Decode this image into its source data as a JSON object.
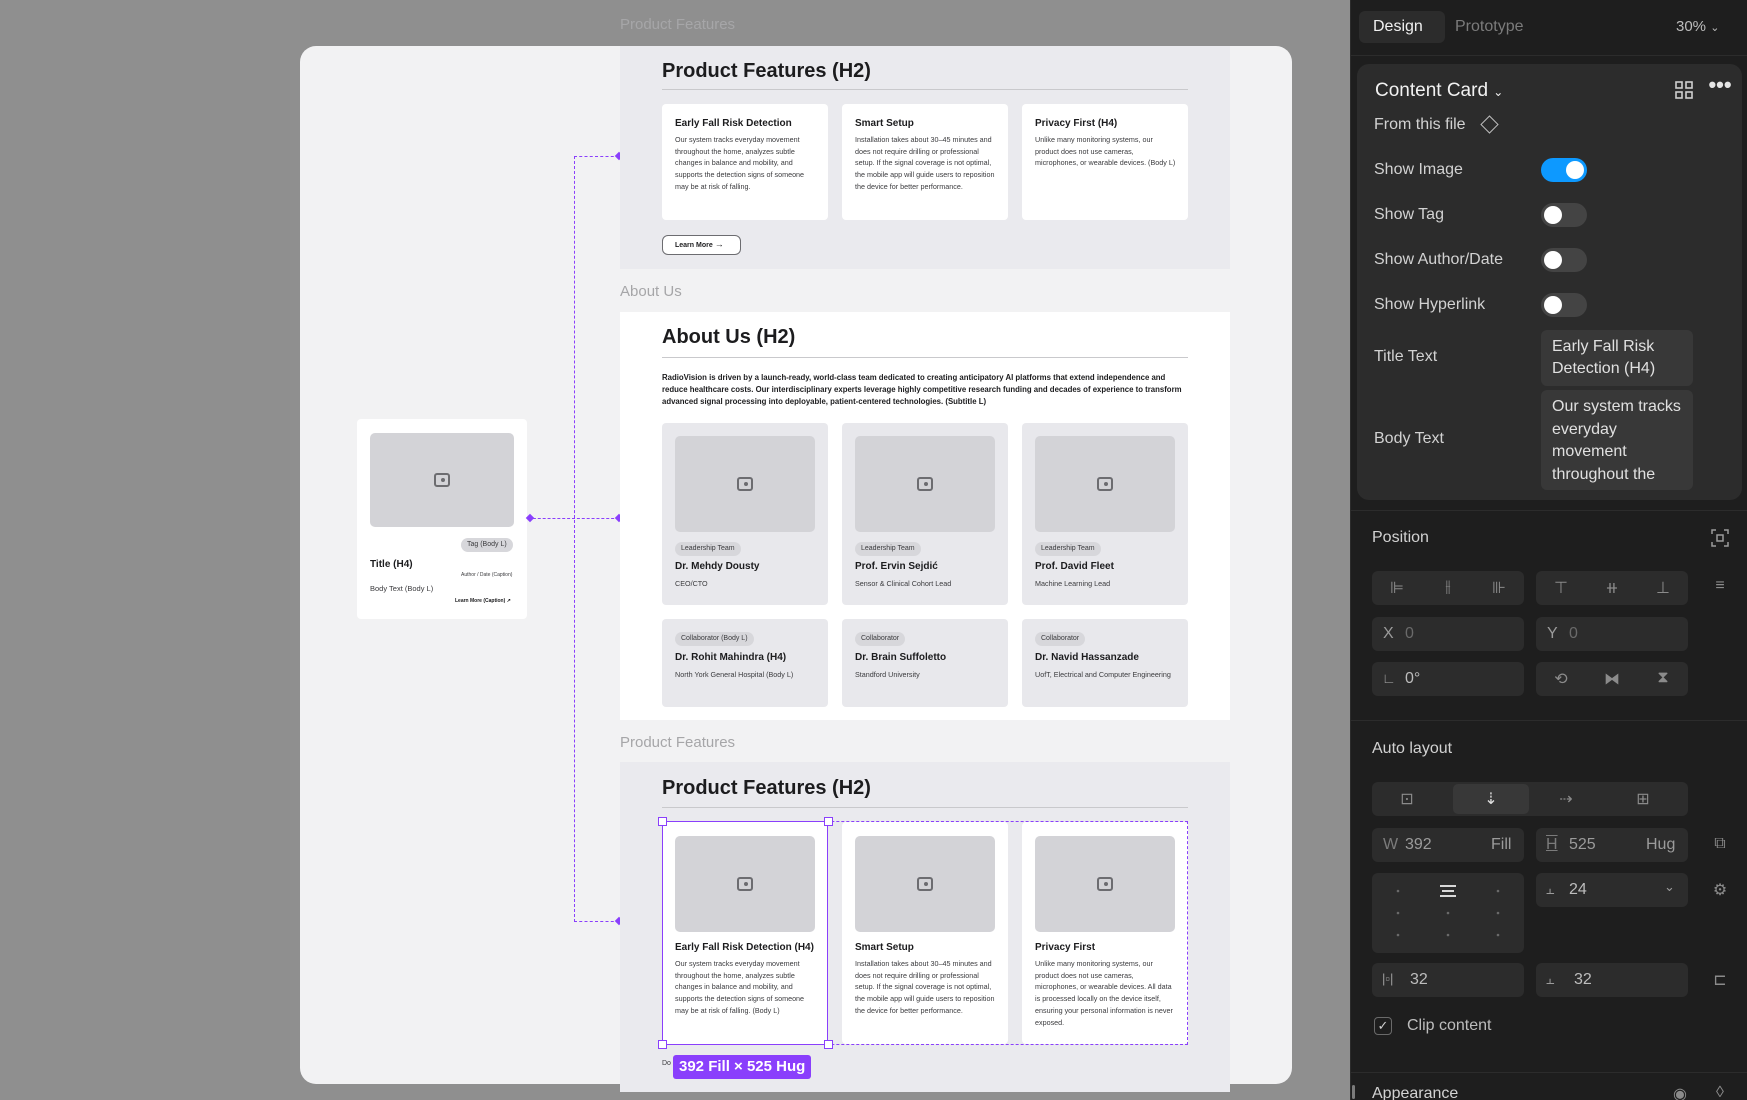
{
  "canvas": {
    "top_label": "Product Features",
    "about_label": "About Us",
    "bottom_label": "Product Features",
    "component_card": {
      "tag": "Tag (Body L)",
      "title": "Title (H4)",
      "author": "Author / Date (Caption)",
      "body": "Body Text (Body L)",
      "link": "Learn More (Caption)"
    },
    "features_top": {
      "heading": "Product Features (H2)",
      "cards": [
        {
          "title": "Early Fall Risk Detection",
          "body": "Our system tracks everyday movement throughout the home, analyzes subtle changes in balance and mobility, and supports the detection signs of someone may be at risk of falling."
        },
        {
          "title": "Smart Setup",
          "body": "Installation takes about 30–45 minutes and does not require drilling or professional setup. If the signal coverage is not optimal, the mobile app will guide users to reposition the device for better performance."
        },
        {
          "title": "Privacy First (H4)",
          "body": "Unlike many monitoring systems, our product does not use cameras, microphones, or wearable devices. (Body L)"
        }
      ],
      "button": "Learn More"
    },
    "about": {
      "heading": "About Us (H2)",
      "intro": "RadioVision is driven by a launch-ready, world-class team dedicated to creating anticipatory AI platforms that extend independence and reduce healthcare costs. Our interdisciplinary experts leverage highly competitive research funding and decades of experience to transform advanced signal processing into deployable, patient-centered technologies. (Subtitle L)",
      "team": [
        {
          "tag": "Leadership Team",
          "name": "Dr. Mehdy Dousty",
          "role": "CEO/CTO"
        },
        {
          "tag": "Leadership Team",
          "name": "Prof. Ervin Sejdić",
          "role": "Sensor & Clinical Cohort Lead"
        },
        {
          "tag": "Leadership Team",
          "name": "Prof. David Fleet",
          "role": "Machine Learning Lead"
        }
      ],
      "collaborators": [
        {
          "tag": "Collaborator (Body L)",
          "name": "Dr. Rohit Mahindra (H4)",
          "role": "North York General Hospital  (Body L)"
        },
        {
          "tag": "Collaborator",
          "name": "Dr. Brain Suffoletto",
          "role": "Standford University"
        },
        {
          "tag": "Collaborator",
          "name": "Dr. Navid Hassanzade",
          "role": "UofT, Electrical and Computer Engineering"
        }
      ]
    },
    "features_bottom": {
      "heading": "Product Features (H2)",
      "cards": [
        {
          "title": "Early Fall Risk Detection (H4)",
          "body": "Our system tracks everyday movement throughout the home, analyzes subtle changes in balance and mobility, and supports the detection signs of someone may be at risk of falling. (Body L)"
        },
        {
          "title": "Smart Setup",
          "body": "Installation takes about 30–45 minutes and does not require drilling or professional setup. If the signal coverage is not optimal, the mobile app will guide users to reposition the device for better performance."
        },
        {
          "title": "Privacy First",
          "body": "Unlike many monitoring systems, our product does not use cameras, microphones, or wearable devices. All data is processed locally on the device itself, ensuring your personal information is never exposed."
        }
      ],
      "below_text": "Do",
      "size_badge": "392 Fill × 525 Hug"
    }
  },
  "panel": {
    "tabs": {
      "design": "Design",
      "prototype": "Prototype"
    },
    "zoom": "30%",
    "component": {
      "name": "Content Card",
      "source": "From this file",
      "props": [
        {
          "label": "Show Image",
          "on": true
        },
        {
          "label": "Show Tag",
          "on": false
        },
        {
          "label": "Show Author/Date",
          "on": false
        },
        {
          "label": "Show Hyperlink",
          "on": false
        }
      ],
      "title_label": "Title Text",
      "title_value": "Early Fall Risk Detection (H4)",
      "body_label": "Body Text",
      "body_value": "Our system tracks everyday movement throughout the"
    },
    "position": {
      "heading": "Position",
      "x_label": "X",
      "x_value": "0",
      "y_label": "Y",
      "y_value": "0",
      "rotation": "0°"
    },
    "auto_layout": {
      "heading": "Auto layout",
      "w_label": "W",
      "w_value": "392",
      "w_mode": "Fill",
      "h_label": "H",
      "h_value": "525",
      "h_mode": "Hug",
      "gap": "24",
      "pad_h": "32",
      "pad_v": "32",
      "clip": "Clip content"
    },
    "appearance": {
      "heading": "Appearance"
    }
  },
  "colors": {
    "accent": "#8a3ffc",
    "toggle_on": "#0d99ff",
    "panel_bg": "#1e1e1e"
  }
}
